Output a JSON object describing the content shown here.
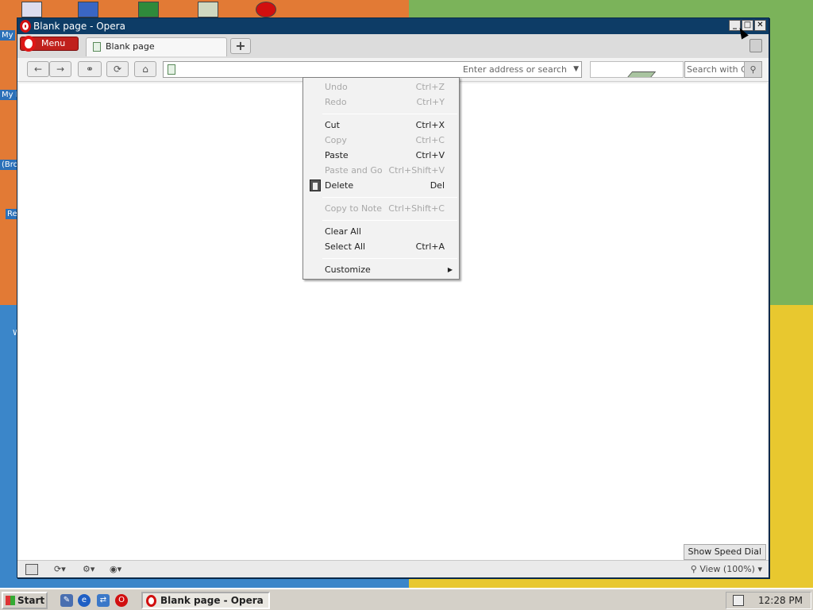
{
  "desktop": {
    "labels": [
      "My",
      "My I",
      "(Bro",
      "Re",
      "W"
    ]
  },
  "window": {
    "title": "Blank page - Opera",
    "controls": {
      "minimize": "_",
      "maximize": "□",
      "close": "✕"
    }
  },
  "tabbar": {
    "menu_label": "Menu",
    "tab_label": "Blank page",
    "new_tab": "+"
  },
  "toolbar": {
    "address_placeholder": "Enter address or search",
    "search_placeholder": "Search with Google"
  },
  "context_menu": {
    "items": [
      {
        "label": "Undo",
        "shortcut": "Ctrl+Z",
        "enabled": false
      },
      {
        "label": "Redo",
        "shortcut": "Ctrl+Y",
        "enabled": false
      },
      {
        "label": "Cut",
        "shortcut": "Ctrl+X",
        "enabled": true
      },
      {
        "label": "Copy",
        "shortcut": "Ctrl+C",
        "enabled": false
      },
      {
        "label": "Paste",
        "shortcut": "Ctrl+V",
        "enabled": true
      },
      {
        "label": "Paste and Go",
        "shortcut": "Ctrl+Shift+V",
        "enabled": false
      },
      {
        "label": "Delete",
        "shortcut": "Del",
        "enabled": true,
        "icon": "trash-icon"
      },
      {
        "label": "Copy to Note",
        "shortcut": "Ctrl+Shift+C",
        "enabled": false
      },
      {
        "label": "Clear All",
        "shortcut": "",
        "enabled": true
      },
      {
        "label": "Select All",
        "shortcut": "Ctrl+A",
        "enabled": true
      },
      {
        "label": "Customize",
        "shortcut": "",
        "enabled": true,
        "submenu": true
      }
    ]
  },
  "page": {
    "speed_dial_label": "Show Speed Dial"
  },
  "statusbar": {
    "zoom_label": "View (100%)"
  },
  "taskbar": {
    "start_label": "Start",
    "task_label": "Blank page - Opera",
    "clock": "12:28 PM"
  },
  "colors": {
    "titlebar": "#0d3c66",
    "opera_red": "#d10f0f",
    "menu_bg": "#f2f2f2"
  }
}
